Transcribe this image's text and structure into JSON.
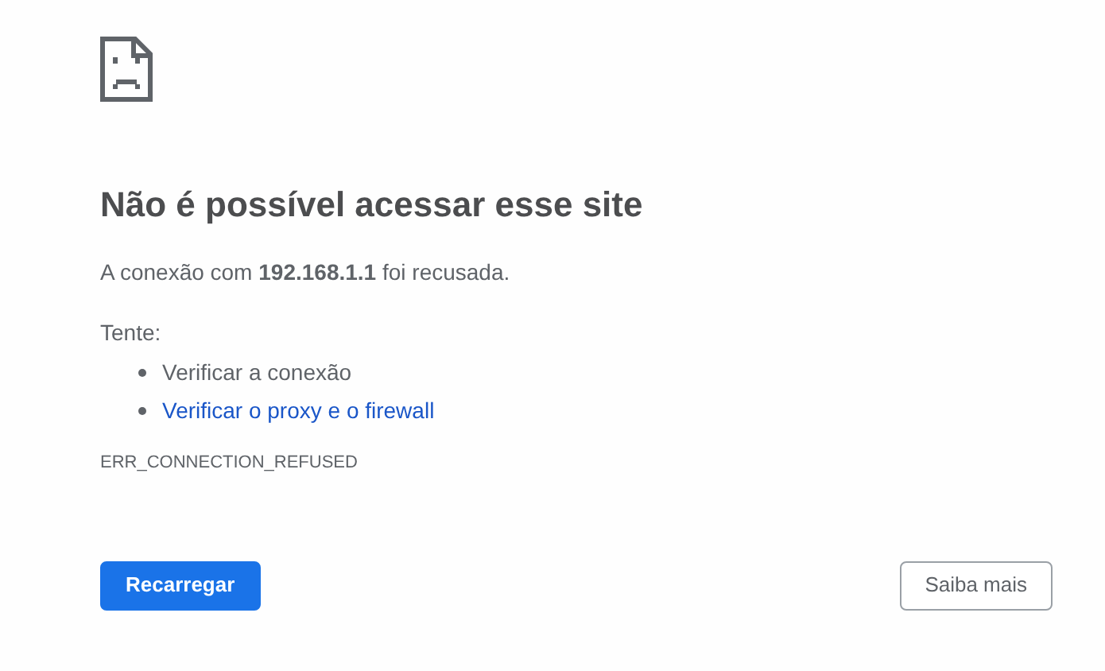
{
  "heading": "Não é possível acessar esse site",
  "message": "A conexão com **192.168.1.1** foi recusada.",
  "suggestions_label": "Tente:",
  "suggestions": [
    {
      "kind": "text",
      "label": "Verificar a conexão"
    },
    {
      "kind": "link",
      "label": "Verificar o proxy e o firewall"
    }
  ],
  "error_code": "ERR_CONNECTION_REFUSED",
  "buttons": [
    {
      "kind": "primary",
      "label": "Recarregar"
    },
    {
      "kind": "secondary",
      "label": "Saiba mais"
    }
  ]
}
